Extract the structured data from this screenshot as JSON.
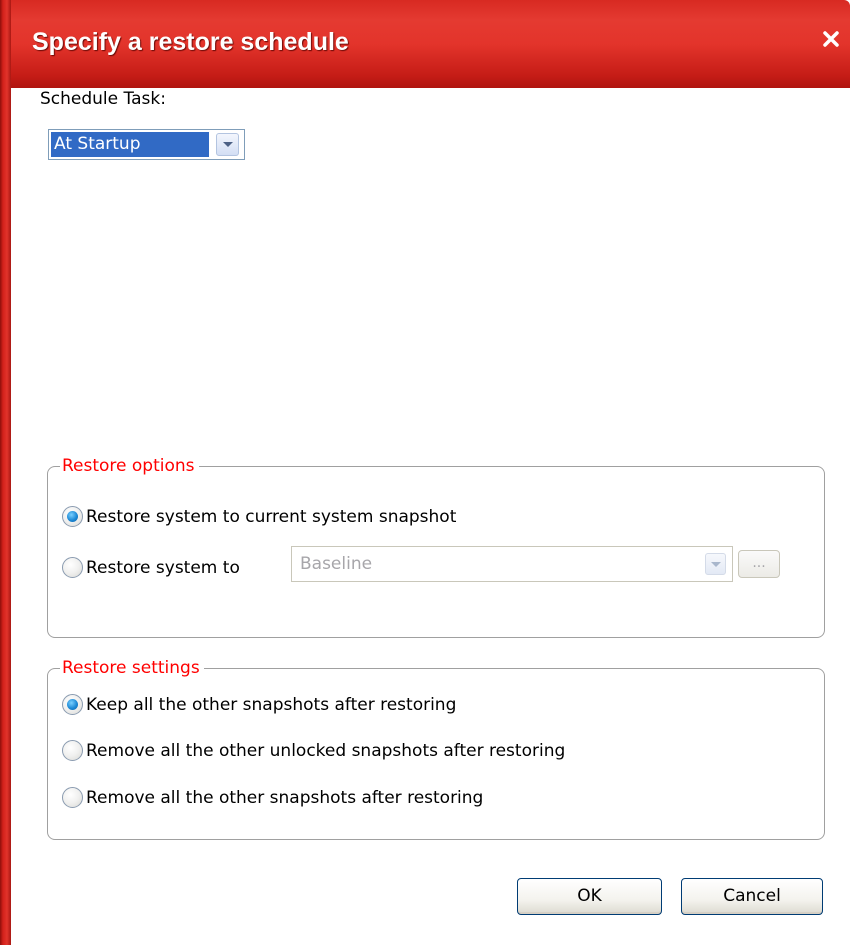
{
  "window": {
    "title": "Specify a restore schedule",
    "close_symbol": "close-icon"
  },
  "schedule": {
    "label": "Schedule Task:",
    "selected": "At Startup"
  },
  "restore_options": {
    "legend": "Restore options",
    "option_current": "Restore system to current system snapshot",
    "option_to": "Restore system to",
    "selected": "option_current",
    "snapshot_value": "Baseline",
    "browse_label": "..."
  },
  "restore_settings": {
    "legend": "Restore settings",
    "keep_all": "Keep all the other snapshots after restoring",
    "remove_unlocked": "Remove all the other unlocked snapshots after restoring",
    "remove_all": "Remove all the other snapshots after restoring",
    "selected": "keep_all"
  },
  "buttons": {
    "ok": "OK",
    "cancel": "Cancel"
  },
  "colors": {
    "titlebar": "#e3342b",
    "legend_text": "#ff0000",
    "selection": "#316ac5"
  }
}
